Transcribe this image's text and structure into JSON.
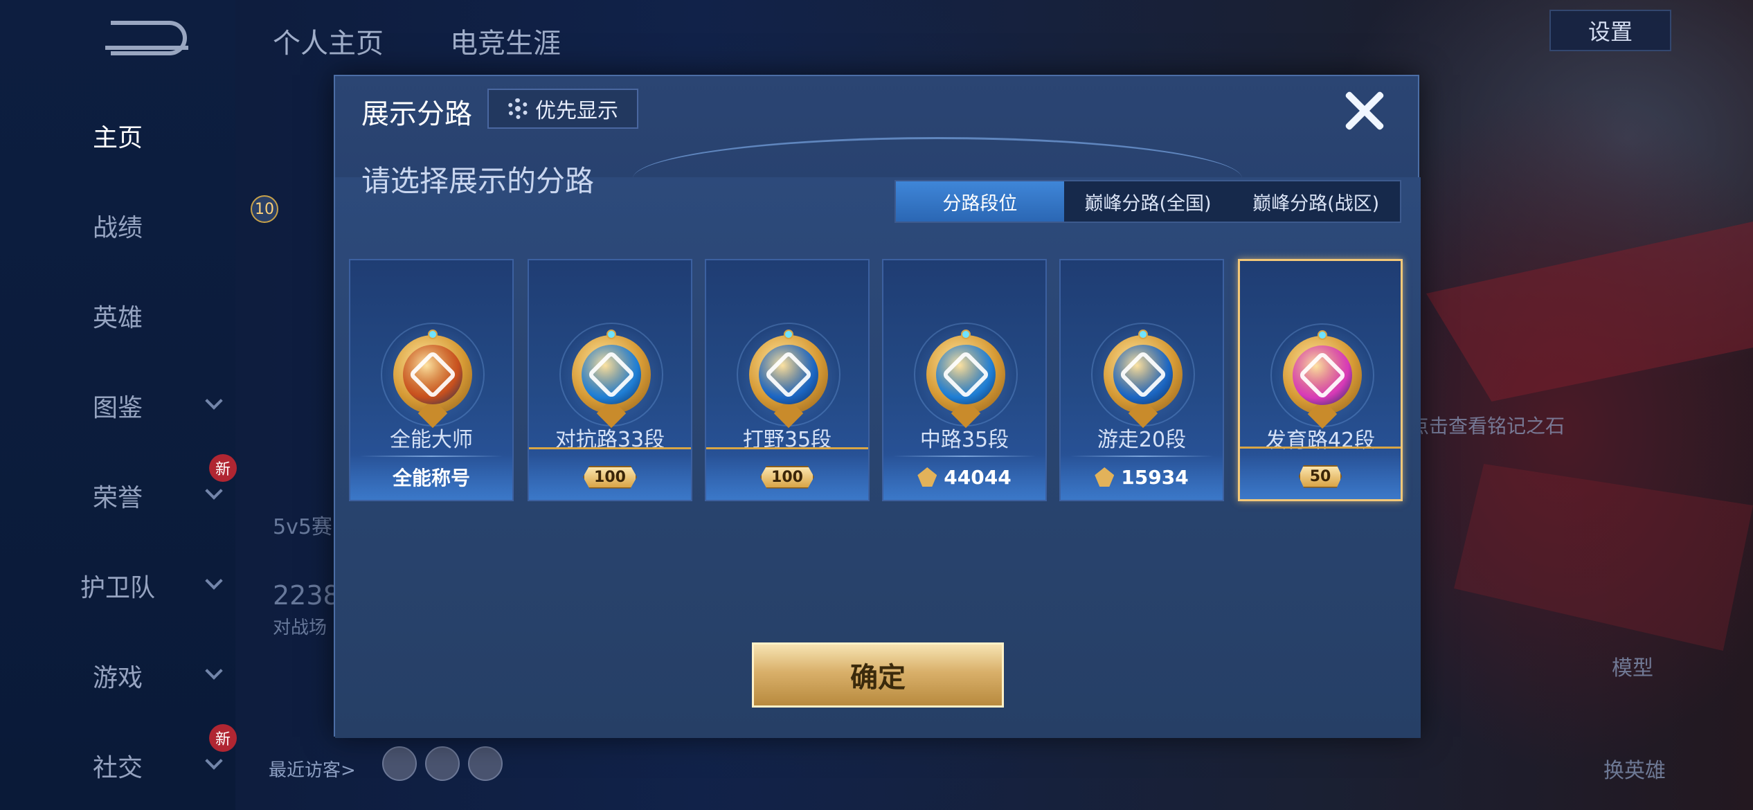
{
  "background": {
    "top_tabs": [
      "个人主页",
      "电竞生涯"
    ],
    "settings_label": "设置",
    "nav": [
      {
        "label": "主页",
        "active": true,
        "chevron": false,
        "new": false
      },
      {
        "label": "战绩",
        "active": false,
        "chevron": false,
        "new": false
      },
      {
        "label": "英雄",
        "active": false,
        "chevron": false,
        "new": false
      },
      {
        "label": "图鉴",
        "active": false,
        "chevron": true,
        "new": false
      },
      {
        "label": "荣誉",
        "active": false,
        "chevron": true,
        "new": true
      },
      {
        "label": "护卫队",
        "active": false,
        "chevron": true,
        "new": false
      },
      {
        "label": "游戏",
        "active": false,
        "chevron": true,
        "new": false
      },
      {
        "label": "社交",
        "active": false,
        "chevron": true,
        "new": true
      }
    ],
    "new_badge": "新",
    "level_badge": "10",
    "stat_partial": "5v5赛",
    "number_partial": "2238",
    "number_sub_partial": "对战场",
    "recent_visitors_label": "最近访客>",
    "stone_hint_partial": "点击查看铭记之石",
    "model_label": "模型",
    "change_hero_label": "换英雄"
  },
  "modal": {
    "title": "展示分路",
    "priority_button": "优先显示",
    "subtitle": "请选择展示的分路",
    "tabs": [
      {
        "label": "分路段位",
        "active": true
      },
      {
        "label": "巅峰分路(全国)",
        "active": false
      },
      {
        "label": "巅峰分路(战区)",
        "active": false
      }
    ],
    "cards": [
      {
        "name": "全能大师",
        "footer": "全能称号",
        "footer_type": "text",
        "selected": false,
        "core_color": "#c8501e",
        "emblem_icon": "all-round-emblem-icon"
      },
      {
        "name": "对抗路33段",
        "footer": "100",
        "footer_type": "badge",
        "selected": false,
        "core_color": "#1f7fd6",
        "emblem_icon": "clash-lane-emblem-icon"
      },
      {
        "name": "打野35段",
        "footer": "100",
        "footer_type": "badge",
        "selected": false,
        "core_color": "#1c67c4",
        "emblem_icon": "jungle-emblem-icon"
      },
      {
        "name": "中路35段",
        "footer": "44044",
        "footer_type": "score",
        "selected": false,
        "core_color": "#1f7fd6",
        "emblem_icon": "mid-lane-emblem-icon"
      },
      {
        "name": "游走20段",
        "footer": "15934",
        "footer_type": "score",
        "selected": false,
        "core_color": "#1c67c4",
        "emblem_icon": "roam-emblem-icon"
      },
      {
        "name": "发育路42段",
        "footer": "50",
        "footer_type": "badge",
        "selected": true,
        "core_color": "#d83ab8",
        "emblem_icon": "farm-lane-emblem-icon"
      }
    ],
    "confirm_button": "确定"
  }
}
